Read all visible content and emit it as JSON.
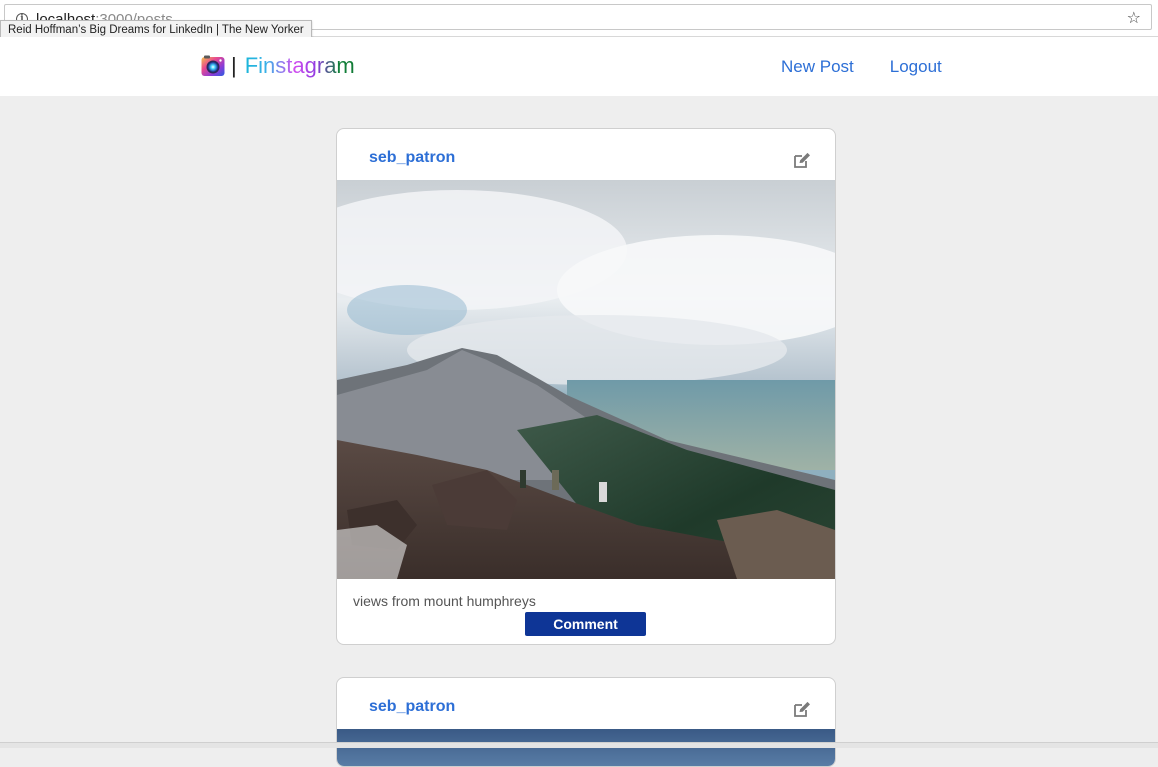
{
  "browser": {
    "url_host": "localhost",
    "url_path": ":3000/posts",
    "tooltip": "Reid Hoffman’s Big Dreams for LinkedIn | The New Yorker"
  },
  "navbar": {
    "separator": "|",
    "brand": "Finstagram",
    "links": [
      {
        "label": "New Post"
      },
      {
        "label": "Logout"
      }
    ]
  },
  "posts": [
    {
      "username": "seb_patron",
      "caption": "views from mount humphreys",
      "comment_label": "Comment"
    },
    {
      "username": "seb_patron"
    }
  ],
  "colors": {
    "link": "#2d6fd6",
    "button": "#0e3596",
    "page_bg": "#eeeeee"
  },
  "icons": [
    "info-icon",
    "star-icon",
    "camera-icon",
    "edit-icon"
  ]
}
